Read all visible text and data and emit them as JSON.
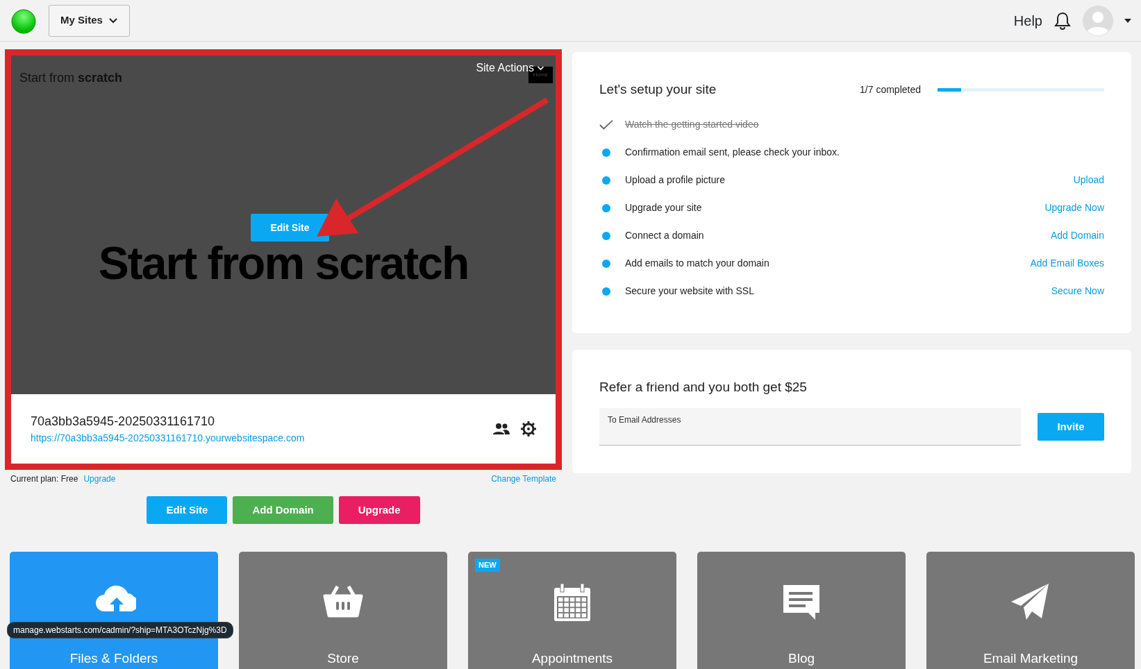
{
  "top_bar": {
    "sites_menu": "My Sites",
    "help": "Help"
  },
  "site_preview": {
    "corner_title": "Start from **scratch**",
    "site_actions": "Site Actions",
    "home_tag": "Home",
    "headline": "Start from scratch",
    "edit_button": "Edit Site",
    "site_name": "70a3bb3a5945-20250331161710",
    "site_url": "https://70a3bb3a5945-20250331161710.yourwebsitespace.com"
  },
  "plan": {
    "label": "Current plan: Free",
    "upgrade_link": "Upgrade",
    "change_template": "Change Template"
  },
  "buttons": [
    {
      "label": "Edit Site",
      "kind": "info"
    },
    {
      "label": "Add Domain",
      "kind": "success"
    },
    {
      "label": "Upgrade",
      "kind": "danger"
    }
  ],
  "setup": {
    "title": "Let's setup your site",
    "progress_text": "1/7 completed",
    "level": 0.14,
    "tasks": [
      {
        "label": "Watch the getting started video",
        "done": true
      },
      {
        "label": "Confirmation email sent, please check your inbox.",
        "done": false
      },
      {
        "label": "Upload a profile picture",
        "done": false,
        "action": "Upload"
      },
      {
        "label": "Upgrade your site",
        "done": false,
        "action": "Upgrade Now"
      },
      {
        "label": "Connect a domain",
        "done": false,
        "action": "Add Domain"
      },
      {
        "label": "Add emails to match your domain",
        "done": false,
        "action": "Add Email Boxes"
      },
      {
        "label": "Secure your website with SSL",
        "done": false,
        "action": "Secure Now"
      }
    ]
  },
  "refer": {
    "title": "Refer a friend and you both get $25",
    "field_label": "To Email Addresses",
    "button": "Invite"
  },
  "tiles": [
    {
      "label": "Files & Folders",
      "kind": "files",
      "selected": true
    },
    {
      "label": "Store",
      "kind": "store",
      "selected": false
    },
    {
      "label": "Appointments",
      "kind": "appointments",
      "selected": false,
      "badge": "NEW"
    },
    {
      "label": "Blog",
      "kind": "blog",
      "selected": false
    },
    {
      "label": "Email Marketing",
      "kind": "email",
      "selected": false
    }
  ],
  "status_url": "manage.webstarts.com/cadmin/?ship=MTA3OTczNjg%3D"
}
